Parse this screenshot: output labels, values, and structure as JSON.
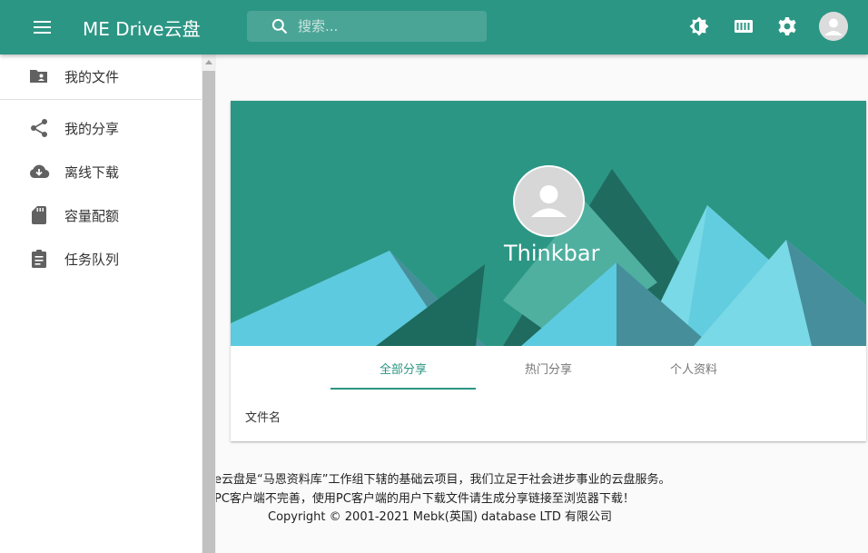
{
  "appbar": {
    "title": "ME Drive云盘",
    "search_placeholder": "搜索...",
    "color": "#2c9684"
  },
  "icons": {
    "menu": "menu-icon",
    "search": "search-icon",
    "theme": "brightness-icon",
    "storage": "memory-card-icon",
    "settings": "gear-icon",
    "account": "account-circle-icon"
  },
  "drawer": {
    "items": [
      {
        "label": "我的文件",
        "icon": "folder-shared-icon"
      },
      {
        "label": "我的分享",
        "icon": "share-icon"
      },
      {
        "label": "离线下载",
        "icon": "cloud-download-icon"
      },
      {
        "label": "容量配额",
        "icon": "sd-card-icon"
      },
      {
        "label": "任务队列",
        "icon": "clipboard-icon"
      }
    ]
  },
  "profile": {
    "username": "Thinkbar",
    "tabs": [
      "全部分享",
      "热门分享",
      "个人资料"
    ],
    "active_tab": "全部分享",
    "column_header": "文件名"
  },
  "footer": {
    "line1": "e云盘是“马恩资料库”工作组下辖的基础云项目，我们立足于社会进步事业的云盘服务。",
    "line2": "PC客户端不完善，使用PC客户端的用户下载文件请生成分享链接至浏览器下载！",
    "line3": "Copyright © 2001-2021 Mebk(英国) database LTD 有限公司"
  }
}
